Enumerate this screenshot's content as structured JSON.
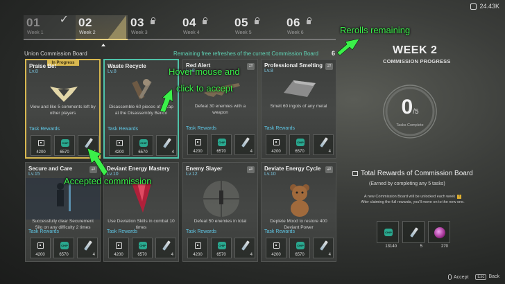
{
  "currency": {
    "icon": "currency-icon",
    "value": "24.43K"
  },
  "weeks": [
    {
      "num": "01",
      "label": "Week 1",
      "state": "done"
    },
    {
      "num": "02",
      "label": "Week 2",
      "state": "current"
    },
    {
      "num": "03",
      "label": "Week 3",
      "state": "locked"
    },
    {
      "num": "04",
      "label": "Week 4",
      "state": "locked"
    },
    {
      "num": "05",
      "label": "Week 5",
      "state": "locked"
    },
    {
      "num": "06",
      "label": "Week 6",
      "state": "locked"
    }
  ],
  "board": {
    "title": "Union Commission Board",
    "refresh_text": "Remaining free refreshes of the current Commission Board",
    "refresh_count": "6"
  },
  "cards": [
    {
      "title": "Praise Be!",
      "level": "Lv.8",
      "tag": "In Progress",
      "desc": "View and like 5 comments left by other players",
      "rewards_label": "Task Rewards",
      "rewards": [
        "4200",
        "6570",
        "4"
      ]
    },
    {
      "title": "Waste Recycle",
      "level": "Lv.8",
      "desc": "Disassemble 60 pieces of Scrap at the Disassembly Bench",
      "rewards_label": "Task Rewards",
      "rewards": [
        "4200",
        "6570",
        "4"
      ]
    },
    {
      "title": "Red Alert",
      "level": "Lv.8",
      "desc": "Defeat 30 enemies with a weapon",
      "rewards_label": "Task Rewards",
      "rewards": [
        "4200",
        "6570",
        "4"
      ]
    },
    {
      "title": "Professional Smelting",
      "level": "Lv.8",
      "desc": "Smelt 60 ingots of any metal",
      "rewards_label": "Task Rewards",
      "rewards": [
        "4200",
        "6570",
        "4"
      ]
    },
    {
      "title": "Secure and Care",
      "level": "Lv.15",
      "desc": "Successfully clear Securement Silo on any difficulty 2 times",
      "rewards_label": "Task Rewards",
      "rewards": [
        "4200",
        "6570",
        "4"
      ]
    },
    {
      "title": "Deviant Energy Mastery",
      "level": "Lv.10",
      "desc": "Use Deviation Skills in combat 10 times",
      "rewards_label": "Task Rewards",
      "rewards": [
        "4200",
        "6570",
        "4"
      ]
    },
    {
      "title": "Enemy Slayer",
      "level": "Lv.12",
      "desc": "Defeat 50 enemies in total",
      "rewards_label": "Task Rewards",
      "rewards": [
        "4200",
        "6570",
        "4"
      ]
    },
    {
      "title": "Deviate Energy Cycle",
      "level": "Lv.10",
      "desc": "Deplete Mood to restore 400 Deviant Power",
      "rewards_label": "Task Rewards",
      "rewards": [
        "4200",
        "6570",
        "4"
      ]
    }
  ],
  "progress": {
    "week_title": "WEEK 2",
    "label": "COMMISSION PROGRESS",
    "done": "0",
    "total": "/5",
    "done_fraction": 0,
    "sub": "Tasks Complete"
  },
  "total_rewards": {
    "title": "Total Rewards of Commission Board",
    "subtitle": "(Earned by completing any 5 tasks)",
    "notice_1": "A new Commission Board will be unlocked each week",
    "notice_2": "After claiming the full rewards, you'll move on to the new one.",
    "values": [
      "13140",
      "5",
      "270"
    ]
  },
  "footer": {
    "accept_label": "Accept",
    "esc_key": "Esc",
    "back_label": "Back"
  },
  "annotations": {
    "rerolls": "Rerolls remaining",
    "hover_1": "Hover mouse and",
    "hover_2": "click to accept",
    "accepted": "Accepted commission",
    "color": "#3bf04a"
  },
  "colors": {
    "accent_teal": "#5fd3b5",
    "in_progress": "#d8b850",
    "level_blue": "#7ac5e0"
  }
}
